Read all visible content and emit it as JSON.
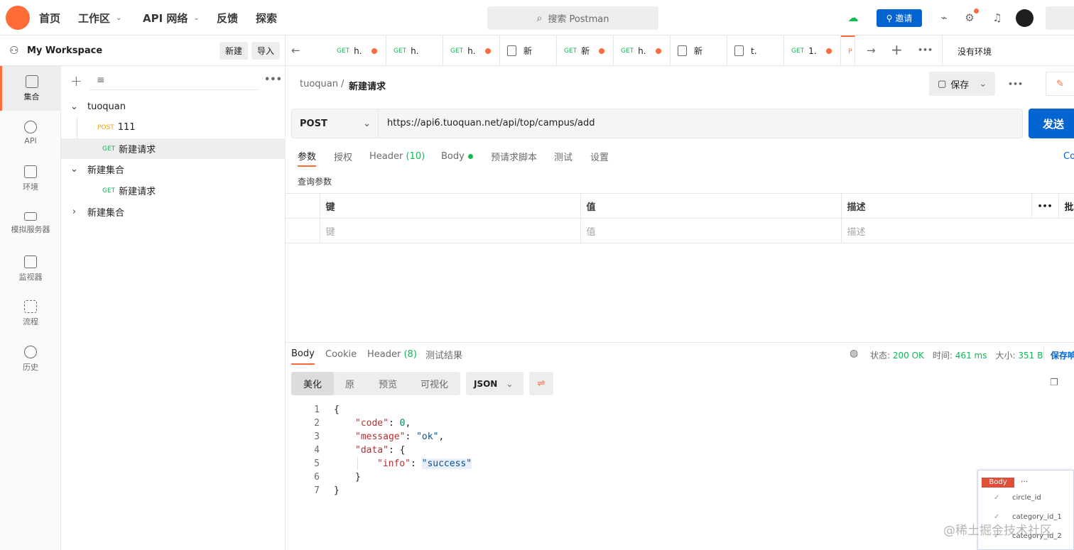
{
  "topbar": {
    "nav": [
      {
        "label": "首页"
      },
      {
        "label": "工作区"
      },
      {
        "label": "API 网络"
      },
      {
        "label": "反馈"
      },
      {
        "label": "探索"
      }
    ],
    "search_placeholder": "搜索 Postman",
    "invite_label": "邀请"
  },
  "workspace": {
    "name": "My Workspace",
    "new_label": "新建",
    "import_label": "导入"
  },
  "rail": [
    {
      "label": "集合",
      "icon": "collection-icon"
    },
    {
      "label": "API",
      "icon": "api-icon"
    },
    {
      "label": "环境",
      "icon": "environment-icon"
    },
    {
      "label": "模拟服务器",
      "icon": "mock-server-icon"
    },
    {
      "label": "监视器",
      "icon": "monitor-icon"
    },
    {
      "label": "流程",
      "icon": "flow-icon"
    },
    {
      "label": "历史",
      "icon": "history-icon"
    }
  ],
  "sidebar": {
    "tree": [
      {
        "label": "tuoquan",
        "method": ""
      },
      {
        "label": "111",
        "method": "POST"
      },
      {
        "label": "新建请求",
        "method": "GET"
      },
      {
        "label": "新建集合",
        "method": ""
      },
      {
        "label": "新建请求",
        "method": "GET"
      },
      {
        "label": "新建集合",
        "method": ""
      }
    ]
  },
  "tabs": [
    {
      "method": "GET",
      "title": "h."
    },
    {
      "method": "GET",
      "title": "h."
    },
    {
      "method": "GET",
      "title": "h."
    },
    {
      "method": "",
      "title": "新"
    },
    {
      "method": "GET",
      "title": "新"
    },
    {
      "method": "GET",
      "title": "h."
    },
    {
      "method": "",
      "title": "新"
    },
    {
      "method": "",
      "title": "t."
    },
    {
      "method": "GET",
      "title": "1."
    },
    {
      "method": "",
      "title": "P"
    }
  ],
  "env_label": "没有环境",
  "request": {
    "breadcrumb_collection": "tuoquan",
    "breadcrumb_sep": "/",
    "name": "新建请求",
    "save_label": "保存",
    "method": "POST",
    "url": "https://api6.tuoquan.net/api/top/campus/add",
    "send_label": "发送",
    "tabs": [
      "参数",
      "授权",
      "Header",
      "(10)",
      "Body",
      "预请求脚本",
      "测试",
      "设置"
    ],
    "cookies_label": "Co",
    "query_params_title": "查询参数",
    "param_headers": [
      "键",
      "值",
      "描述"
    ],
    "param_placeholders": [
      "键",
      "值",
      "描述"
    ],
    "bulk_edit": "批"
  },
  "response": {
    "tabs": [
      "Body",
      "Cookie",
      "Header",
      "(8)",
      "测试结果"
    ],
    "status_label": "状态:",
    "status": "200 OK",
    "time_label": "时间:",
    "time": "461 ms",
    "size_label": "大小:",
    "size": "351 B",
    "save_response": "保存响",
    "view_modes": [
      "美化",
      "原",
      "预览",
      "可视化"
    ],
    "format": "JSON",
    "lines": [
      "1",
      "2",
      "3",
      "4",
      "5",
      "6",
      "7"
    ],
    "json": {
      "code_key": "\"code\"",
      "code_val": "0",
      "message_key": "\"message\"",
      "message_val": "\"ok\"",
      "data_key": "\"data\"",
      "info_key": "\"info\"",
      "info_val": "\"success\""
    }
  },
  "popup": {
    "badge": "Body",
    "more": "…",
    "fields": [
      "circle_id",
      "category_id_1",
      "category_id_2"
    ]
  },
  "watermark": "@稀土掘金技术社区",
  "colors": {
    "accent": "#ff6c37",
    "primary": "#0265d2",
    "success": "#0cbb52"
  }
}
